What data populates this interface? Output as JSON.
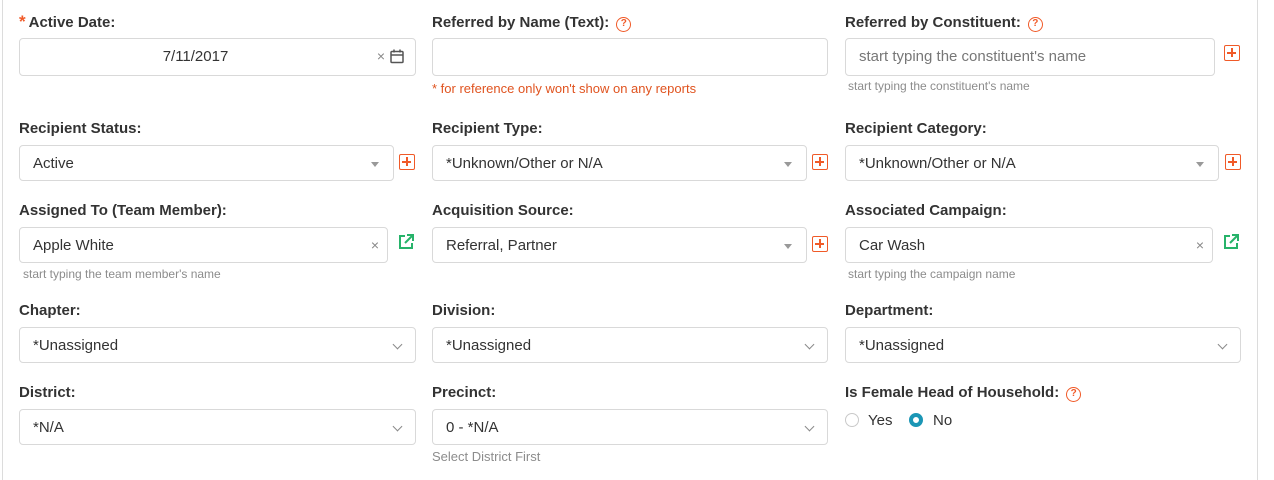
{
  "fields": {
    "active_date": {
      "label": "Active Date:",
      "required_mark": "*",
      "value": "7/11/2017",
      "clear": "×"
    },
    "referred_by_name": {
      "label": "Referred by Name (Text):",
      "help": "?",
      "value": "",
      "note": "* for reference only won't show on any reports"
    },
    "referred_by_constituent": {
      "label": "Referred by Constituent:",
      "help": "?",
      "placeholder": "start typing the constituent's name",
      "hint": "start typing the constituent's name"
    },
    "recipient_status": {
      "label": "Recipient Status:",
      "value": "Active"
    },
    "recipient_type": {
      "label": "Recipient Type:",
      "value": "*Unknown/Other or N/A"
    },
    "recipient_category": {
      "label": "Recipient Category:",
      "value": "*Unknown/Other or N/A"
    },
    "assigned_to": {
      "label": "Assigned To (Team Member):",
      "value": "Apple White",
      "clear": "×",
      "hint": "start typing the team member's name"
    },
    "acquisition_source": {
      "label": "Acquisition Source:",
      "value": "Referral, Partner"
    },
    "associated_campaign": {
      "label": "Associated Campaign:",
      "value": "Car Wash",
      "clear": "×",
      "hint": "start typing the campaign name"
    },
    "chapter": {
      "label": "Chapter:",
      "value": "*Unassigned"
    },
    "division": {
      "label": "Division:",
      "value": "*Unassigned"
    },
    "department": {
      "label": "Department:",
      "value": "*Unassigned"
    },
    "district": {
      "label": "District:",
      "value": "*N/A"
    },
    "precinct": {
      "label": "Precinct:",
      "value": "0 - *N/A",
      "hint": "Select District First"
    },
    "female_head": {
      "label": "Is Female Head of Household:",
      "help": "?",
      "options": [
        "Yes",
        "No"
      ],
      "selected": "No"
    }
  },
  "icons": {
    "add": "plus-square-icon",
    "open": "external-link-icon",
    "calendar": "calendar-icon",
    "help": "question-circle-icon"
  },
  "colors": {
    "accent": "#f05a28",
    "link": "#27b36a",
    "radio": "#1b96b5",
    "hint": "#8c8c8c"
  }
}
